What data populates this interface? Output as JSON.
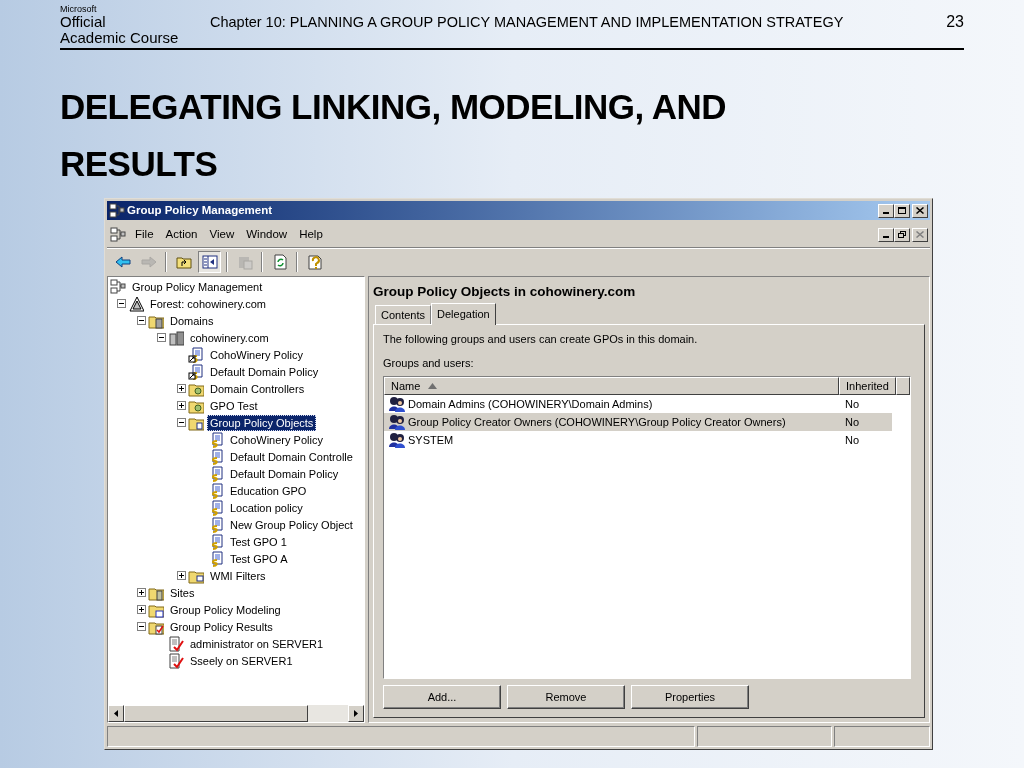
{
  "slide": {
    "logo": {
      "brand": "Microsoft",
      "line_1": "Official",
      "line_2": "Academic Course"
    },
    "chapter": "Chapter 10: PLANNING A GROUP POLICY MANAGEMENT AND IMPLEMENTATION STRATEGY",
    "page_number": "23",
    "title": "DELEGATING LINKING, MODELING, AND RESULTS"
  },
  "window": {
    "title": "Group Policy Management",
    "menu": [
      "File",
      "Action",
      "View",
      "Window",
      "Help"
    ],
    "toolbar": [
      {
        "kind": "back",
        "disabled": false,
        "pressed": false
      },
      {
        "kind": "forward",
        "disabled": true,
        "pressed": false
      },
      {
        "kind": "separator"
      },
      {
        "kind": "up",
        "disabled": false,
        "pressed": false
      },
      {
        "kind": "toggle-tree",
        "disabled": false,
        "pressed": true
      },
      {
        "kind": "separator"
      },
      {
        "kind": "export",
        "disabled": true,
        "pressed": false
      },
      {
        "kind": "separator"
      },
      {
        "kind": "refresh",
        "disabled": false,
        "pressed": false
      },
      {
        "kind": "separator"
      },
      {
        "kind": "help",
        "disabled": false,
        "pressed": false
      }
    ],
    "tree": [
      {
        "kind": "console",
        "label": "Group Policy Management",
        "selected": false,
        "children": [
          {
            "kind": "forest",
            "label": "Forest: cohowinery.com",
            "expanded": true,
            "selected": false,
            "children": [
              {
                "kind": "domains",
                "label": "Domains",
                "expanded": true,
                "selected": false,
                "children": [
                  {
                    "kind": "domain",
                    "label": "cohowinery.com",
                    "expanded": true,
                    "selected": false,
                    "children": [
                      {
                        "kind": "gpo-link",
                        "label": "CohoWinery Policy",
                        "selected": false
                      },
                      {
                        "kind": "gpo-link",
                        "label": "Default Domain Policy",
                        "selected": false
                      },
                      {
                        "kind": "ou",
                        "label": "Domain Controllers",
                        "expanded": false,
                        "selected": false
                      },
                      {
                        "kind": "ou",
                        "label": "GPO Test",
                        "expanded": false,
                        "selected": false
                      },
                      {
                        "kind": "container",
                        "label": "Group Policy Objects",
                        "expanded": true,
                        "selected": true,
                        "children": [
                          {
                            "kind": "gpo",
                            "label": "CohoWinery Policy",
                            "selected": false
                          },
                          {
                            "kind": "gpo",
                            "label": "Default Domain Controlle",
                            "selected": false
                          },
                          {
                            "kind": "gpo",
                            "label": "Default Domain Policy",
                            "selected": false
                          },
                          {
                            "kind": "gpo",
                            "label": "Education GPO",
                            "selected": false
                          },
                          {
                            "kind": "gpo",
                            "label": "Location policy",
                            "selected": false
                          },
                          {
                            "kind": "gpo",
                            "label": "New Group Policy Object",
                            "selected": false
                          },
                          {
                            "kind": "gpo",
                            "label": "Test GPO 1",
                            "selected": false
                          },
                          {
                            "kind": "gpo",
                            "label": "Test GPO A",
                            "selected": false
                          }
                        ]
                      },
                      {
                        "kind": "wmi",
                        "label": "WMI Filters",
                        "expanded": false,
                        "selected": false
                      }
                    ]
                  }
                ]
              },
              {
                "kind": "sites",
                "label": "Sites",
                "expanded": false,
                "selected": false
              },
              {
                "kind": "modeling",
                "label": "Group Policy Modeling",
                "expanded": false,
                "selected": false
              },
              {
                "kind": "results",
                "label": "Group Policy Results",
                "expanded": true,
                "selected": false,
                "children": [
                  {
                    "kind": "report",
                    "label": "administrator on SERVER1",
                    "selected": false
                  },
                  {
                    "kind": "report",
                    "label": "Sseely on SERVER1",
                    "selected": false
                  }
                ]
              }
            ]
          }
        ]
      }
    ],
    "details": {
      "heading": "Group Policy Objects in cohowinery.com",
      "tabs": [
        {
          "label": "Contents",
          "selected": false
        },
        {
          "label": "Delegation",
          "selected": true
        }
      ],
      "description": "The following groups and users can create GPOs in this domain.",
      "list_label": "Groups and users:",
      "columns": [
        {
          "label": "Name",
          "sorted": true
        },
        {
          "label": "Inherited",
          "sorted": false
        }
      ],
      "rows": [
        {
          "name": "Domain Admins (COHOWINERY\\Domain Admins)",
          "inherited": "No",
          "selected": false
        },
        {
          "name": "Group Policy Creator Owners (COHOWINERY\\Group Policy Creator Owners)",
          "inherited": "No",
          "selected": true
        },
        {
          "name": "SYSTEM",
          "inherited": "No",
          "selected": false
        }
      ],
      "buttons": [
        "Add...",
        "Remove",
        "Properties"
      ]
    }
  }
}
